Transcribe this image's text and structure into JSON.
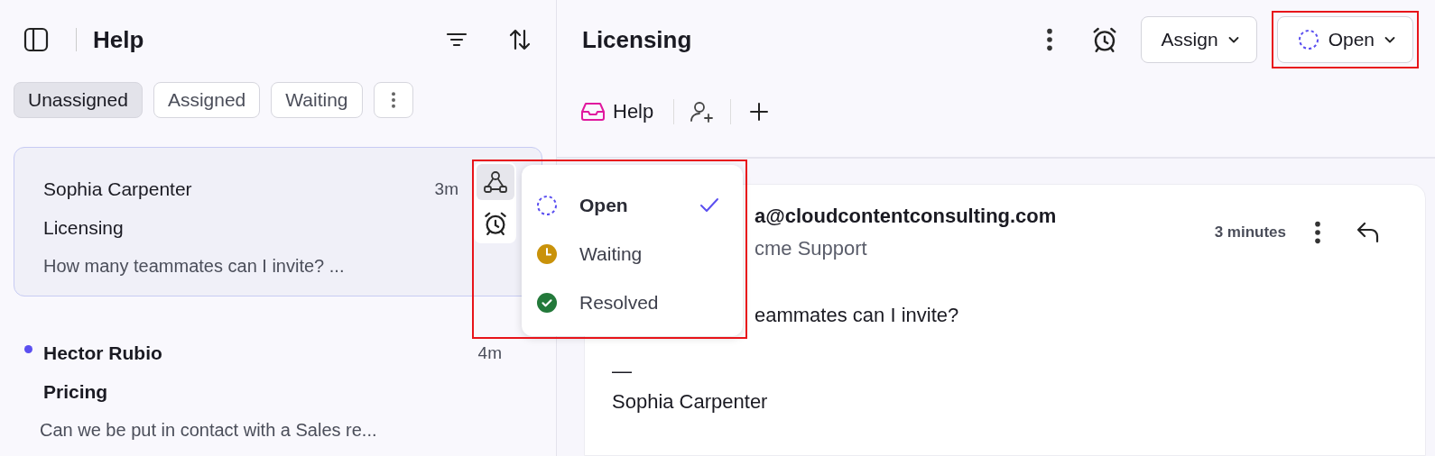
{
  "sidebar": {
    "title": "Help",
    "tabs": [
      {
        "label": "Unassigned",
        "selected": true
      },
      {
        "label": "Assigned",
        "selected": false
      },
      {
        "label": "Waiting",
        "selected": false
      }
    ],
    "conversations": [
      {
        "name": "Sophia Carpenter",
        "time": "3m",
        "subject": "Licensing",
        "preview": "How many teammates can I invite? ...",
        "selected": true,
        "unread": false
      },
      {
        "name": "Hector Rubio",
        "time": "4m",
        "subject": "Pricing",
        "preview": "Can we be put in contact with a Sales re...",
        "selected": false,
        "unread": true
      }
    ]
  },
  "status_menu": {
    "highlighted": true,
    "items": [
      {
        "label": "Open",
        "kind": "open",
        "selected": true
      },
      {
        "label": "Waiting",
        "kind": "waiting",
        "selected": false
      },
      {
        "label": "Resolved",
        "kind": "resolved",
        "selected": false
      }
    ]
  },
  "conversation": {
    "title": "Licensing",
    "assign_button": "Assign",
    "status_button": {
      "label": "Open",
      "kind": "open",
      "highlighted": true
    },
    "inbox": "Help",
    "message": {
      "sender": "a@cloudcontentconsulting.com",
      "recipient": "cme Support",
      "time": "3 minutes",
      "body": "eammates can I invite?",
      "signature_rule": "—",
      "signature": "Sophia Carpenter"
    }
  }
}
